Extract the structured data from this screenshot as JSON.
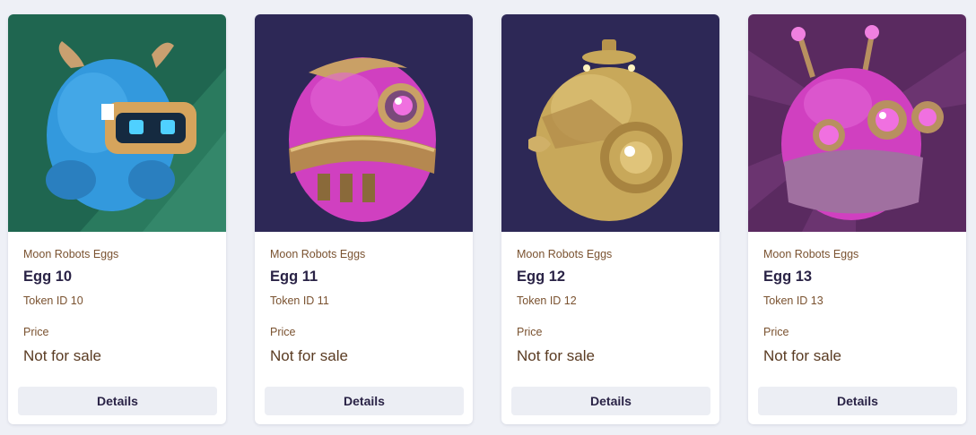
{
  "cards": [
    {
      "collection": "Moon Robots Eggs",
      "title": "Egg 10",
      "token": "Token ID 10",
      "price_label": "Price",
      "price_value": "Not for sale",
      "button_label": "Details",
      "image": {
        "subject": "blue-robot-egg",
        "background": "#1f6650",
        "body": "#3399dd",
        "accent": "#d6a45c"
      }
    },
    {
      "collection": "Moon Robots Eggs",
      "title": "Egg 11",
      "token": "Token ID 11",
      "price_label": "Price",
      "price_value": "Not for sale",
      "button_label": "Details",
      "image": {
        "subject": "pink-gold-robot-egg",
        "background": "#2d2856",
        "body": "#d040c0",
        "accent": "#c9a066"
      }
    },
    {
      "collection": "Moon Robots Eggs",
      "title": "Egg 12",
      "token": "Token ID 12",
      "price_label": "Price",
      "price_value": "Not for sale",
      "button_label": "Details",
      "image": {
        "subject": "gold-robot-egg",
        "background": "#2d2856",
        "body": "#c8a85a",
        "accent": "#e8d08a"
      }
    },
    {
      "collection": "Moon Robots Eggs",
      "title": "Egg 13",
      "token": "Token ID 13",
      "price_label": "Price",
      "price_value": "Not for sale",
      "button_label": "Details",
      "image": {
        "subject": "pink-antenna-robot-egg",
        "background": "#5a2a60",
        "body": "#d040c0",
        "accent": "#b89060"
      }
    }
  ]
}
